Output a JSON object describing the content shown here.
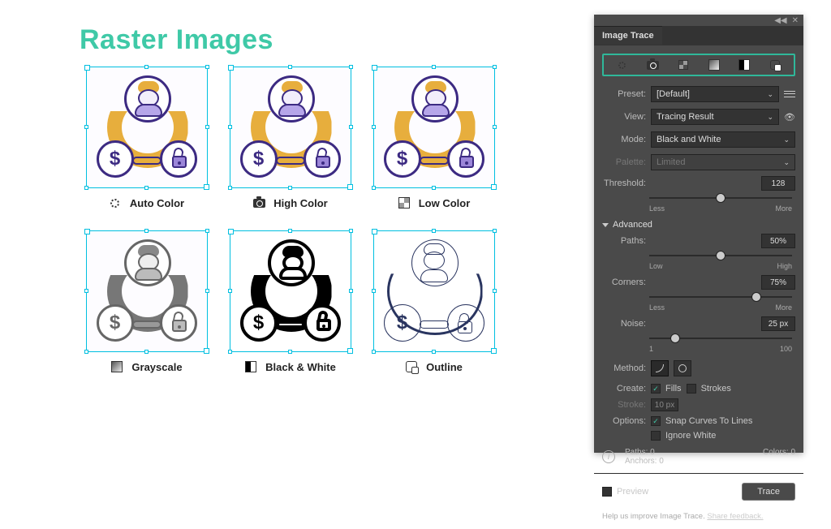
{
  "title": "Raster Images",
  "examples": [
    {
      "id": "auto-color",
      "label": "Auto Color",
      "icon": "gear"
    },
    {
      "id": "high-color",
      "label": "High Color",
      "icon": "camera"
    },
    {
      "id": "low-color",
      "label": "Low Color",
      "icon": "grid4"
    },
    {
      "id": "grayscale",
      "label": "Grayscale",
      "icon": "grad"
    },
    {
      "id": "black-white",
      "label": "Black & White",
      "icon": "halfbox"
    },
    {
      "id": "outline",
      "label": "Outline",
      "icon": "sqo"
    }
  ],
  "panel": {
    "title": "Image Trace",
    "fields": {
      "preset_label": "Preset:",
      "preset_value": "[Default]",
      "view_label": "View:",
      "view_value": "Tracing Result",
      "mode_label": "Mode:",
      "mode_value": "Black and White",
      "palette_label": "Palette:",
      "palette_value": "Limited"
    },
    "sliders": {
      "threshold": {
        "label": "Threshold:",
        "value": "128",
        "low": "Less",
        "high": "More",
        "pos": 50
      },
      "paths": {
        "label": "Paths:",
        "value": "50%",
        "low": "Low",
        "high": "High",
        "pos": 50
      },
      "corners": {
        "label": "Corners:",
        "value": "75%",
        "low": "Less",
        "high": "More",
        "pos": 75
      },
      "noise": {
        "label": "Noise:",
        "value": "25 px",
        "low": "1",
        "high": "100",
        "pos": 18
      }
    },
    "advanced_label": "Advanced",
    "method_label": "Method:",
    "create_label": "Create:",
    "create_fills": "Fills",
    "create_strokes": "Strokes",
    "stroke_label": "Stroke:",
    "stroke_value": "10 px",
    "options_label": "Options:",
    "opt_snap": "Snap Curves To Lines",
    "opt_ignore": "Ignore White",
    "info": {
      "paths_label": "Paths:",
      "paths_value": "0",
      "colors_label": "Colors:",
      "colors_value": "0",
      "anchors_label": "Anchors:",
      "anchors_value": "0"
    },
    "preview_label": "Preview",
    "trace_button": "Trace",
    "help_text": "Help us improve Image Trace. ",
    "help_link": "Share feedback."
  }
}
